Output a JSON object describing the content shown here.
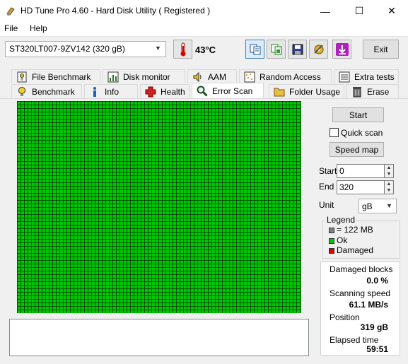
{
  "window": {
    "title": "HD Tune Pro 4.60 - Hard Disk Utility  ( Registered )",
    "minimize_glyph": "—",
    "maximize_glyph": "☐",
    "close_glyph": "✕"
  },
  "menu": {
    "file": "File",
    "help": "Help"
  },
  "toolbar": {
    "drive": "ST320LT007-9ZV142 (320 gB)",
    "temperature": "43°C",
    "exit_label": "Exit",
    "icons": [
      "thermometer-icon",
      "copy-text-icon",
      "copy-screenshot-icon",
      "save-icon",
      "options-icon",
      "exit-arrow-icon"
    ]
  },
  "tabs": {
    "row1": [
      {
        "label": "File Benchmark",
        "icon": "file-benchmark-icon"
      },
      {
        "label": "Disk monitor",
        "icon": "disk-monitor-icon"
      },
      {
        "label": "AAM",
        "icon": "speaker-icon"
      },
      {
        "label": "Random Access",
        "icon": "random-access-icon"
      },
      {
        "label": "Extra tests",
        "icon": "extra-tests-icon"
      }
    ],
    "row2": [
      {
        "label": "Benchmark",
        "icon": "lightbulb-icon"
      },
      {
        "label": "Info",
        "icon": "info-icon"
      },
      {
        "label": "Health",
        "icon": "health-cross-icon"
      },
      {
        "label": "Error Scan",
        "icon": "magnifier-icon"
      },
      {
        "label": "Folder Usage",
        "icon": "folder-icon"
      },
      {
        "label": "Erase",
        "icon": "trash-icon"
      }
    ],
    "active": "Error Scan"
  },
  "scan": {
    "start_button": "Start",
    "quick_scan_label": "Quick scan",
    "quick_scan_checked": false,
    "speed_map_button": "Speed map",
    "start_label": "Start",
    "start_value": "0",
    "end_label": "End",
    "end_value": "320",
    "unit_label": "Unit",
    "unit_value": "gB"
  },
  "legend": {
    "title": "Legend",
    "block": "= 122 MB",
    "ok": "Ok",
    "damaged": "Damaged",
    "colors": {
      "block": "#808080",
      "ok": "#00c800",
      "damaged": "#e00000"
    }
  },
  "stats": {
    "damaged_label": "Damaged blocks",
    "damaged_value": "0.0 %",
    "speed_label": "Scanning speed",
    "speed_value": "61.1 MB/s",
    "position_label": "Position",
    "position_value": "319 gB",
    "elapsed_label": "Elapsed time",
    "elapsed_value": "59:51"
  }
}
